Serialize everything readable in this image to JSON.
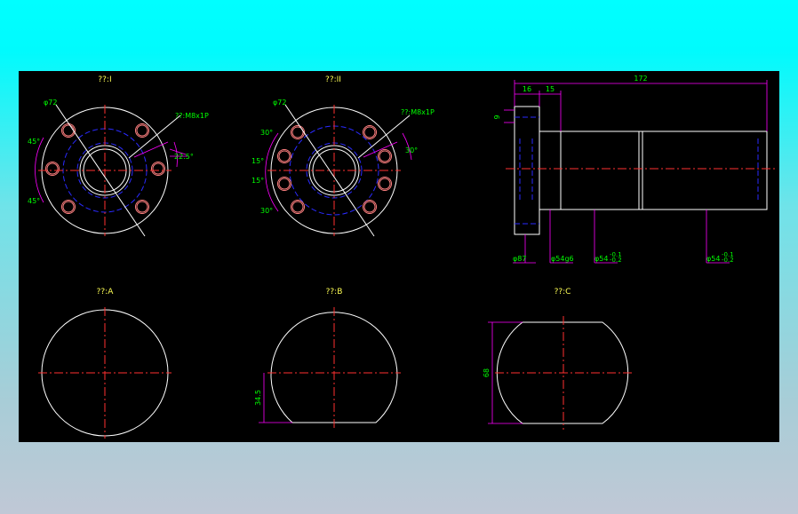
{
  "colors": {
    "background_top": "#00ffff",
    "background_bottom": "#c0c8d6",
    "canvas": "#000000",
    "outline": "#ffffff",
    "centerline": "#ff3030",
    "hidden_line": "#2a2aff",
    "dimension_line": "#ff00ff",
    "dimension_text": "#00ff00",
    "view_label": "#ffff55"
  },
  "views": {
    "flange_i": {
      "label": "??:I",
      "dia_bolt_circle": "φ72",
      "thread_callout": "??:M8x1P",
      "angle_top": "45°",
      "angle_bottom": "45°",
      "angle_right": "22.5°"
    },
    "flange_ii": {
      "label": "??:II",
      "dia_bolt_circle": "φ72",
      "thread_callout": "??:M8x1P",
      "angle_a": "30°",
      "angle_b": "15°",
      "angle_c": "15°",
      "angle_d": "30°",
      "angle_right": "30°"
    },
    "side": {
      "len_overall": "172",
      "len_flange": "16",
      "len_step": "15",
      "thick_small": "9",
      "dia_flange": "φ87",
      "dia_shaft": "φ54g6",
      "dia_tol_1": "φ54",
      "dia_tol_1_sup": "-0.1",
      "dia_tol_1_sub": "-0.2",
      "dia_tol_2": "φ54",
      "dia_tol_2_sup": "-0.1",
      "dia_tol_2_sub": "-0.2"
    },
    "section_a": {
      "label": "??:A"
    },
    "section_b": {
      "label": "??:B",
      "dim": "34.5"
    },
    "section_c": {
      "label": "??:C",
      "dim": "68"
    }
  }
}
